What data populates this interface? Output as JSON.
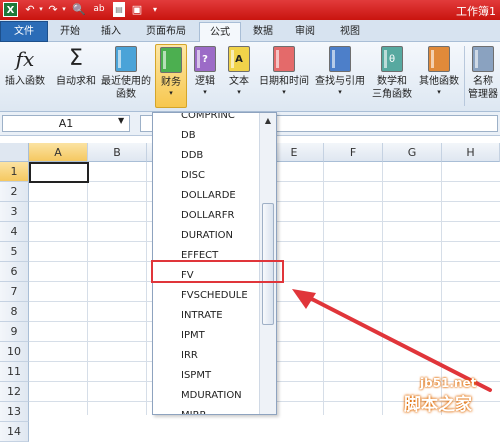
{
  "titlebar": {
    "app_icon": "X",
    "title": "工作簿1",
    "quick_access": [
      "excel-icon",
      "undo-icon",
      "redo-icon",
      "print-preview-icon",
      "spelling-icon",
      "new-document-icon",
      "save-icon",
      "customize-icon"
    ]
  },
  "tabs": [
    {
      "label": "文件"
    },
    {
      "label": "开始"
    },
    {
      "label": "插入"
    },
    {
      "label": "页面布局"
    },
    {
      "label": "公式"
    },
    {
      "label": "数据"
    },
    {
      "label": "审阅"
    },
    {
      "label": "视图"
    }
  ],
  "ribbon": {
    "insert_function": {
      "icon": "fx",
      "label": "插入函数"
    },
    "autosum": {
      "icon": "Σ",
      "label": "自动求和"
    },
    "recent": {
      "label1": "最近使用的",
      "label2": "函数"
    },
    "financial": {
      "label": "财务"
    },
    "logical": {
      "icon": "?",
      "label": "逻辑"
    },
    "text": {
      "icon": "A",
      "label": "文本"
    },
    "datetime": {
      "label": "日期和时间"
    },
    "lookup": {
      "label": "查找与引用"
    },
    "math": {
      "icon": "θ",
      "label1": "数学和",
      "label2": "三角函数"
    },
    "more": {
      "label": "其他函数"
    },
    "name_manager": {
      "label1": "名称",
      "label2": "管理器"
    }
  },
  "formula_bar": {
    "name_box": "A1",
    "formula": ""
  },
  "grid": {
    "columns": [
      "A",
      "B",
      "C",
      "D",
      "E",
      "F",
      "G",
      "H"
    ],
    "rows": [
      "1",
      "2",
      "3",
      "4",
      "5",
      "6",
      "7",
      "8",
      "9",
      "10",
      "11",
      "12",
      "13",
      "14"
    ],
    "active_cell": "A1"
  },
  "dropdown": {
    "items": [
      "COMPRINC",
      "DB",
      "DDB",
      "DISC",
      "DOLLARDE",
      "DOLLARFR",
      "DURATION",
      "EFFECT",
      "FV",
      "FVSCHEDULE",
      "INTRATE",
      "IPMT",
      "IRR",
      "ISPMT",
      "MDURATION",
      "MIRR"
    ],
    "highlighted": "FV"
  },
  "watermark": {
    "site": "jb51.net",
    "name": "脚本之家"
  },
  "colors": {
    "title_red": "#c9140f",
    "file_tab": "#2b6cb7",
    "highlight_red": "#e0353a",
    "active_button": "#f7c74f"
  }
}
